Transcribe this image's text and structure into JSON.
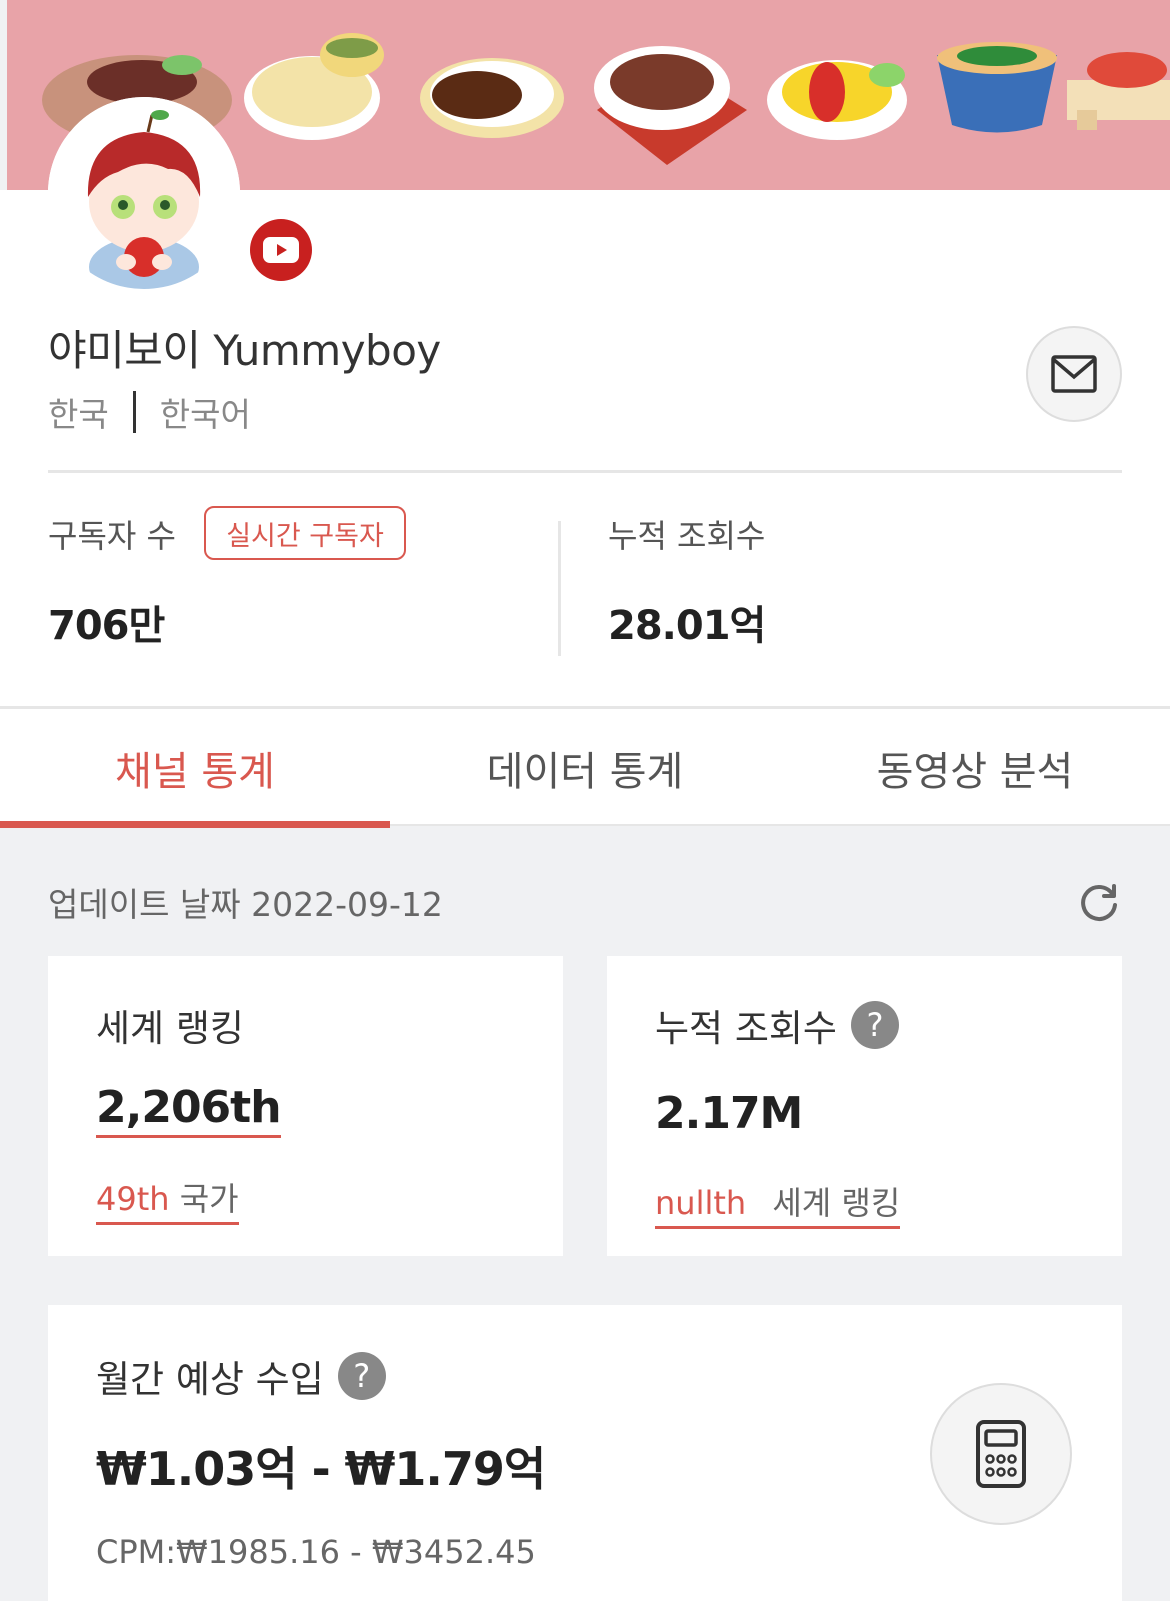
{
  "channel": {
    "name": "야미보이 Yummyboy",
    "country": "한국",
    "language": "한국어",
    "platform_icon": "youtube-icon"
  },
  "stats": {
    "subscribers_label": "구독자 수",
    "realtime_label": "실시간 구독자",
    "subscribers_value": "706만",
    "views_label": "누적 조회수",
    "views_value": "28.01억"
  },
  "tabs": [
    {
      "label": "채널 통계",
      "active": true
    },
    {
      "label": "데이터 통계",
      "active": false
    },
    {
      "label": "동영상 분석",
      "active": false
    }
  ],
  "update": {
    "label": "업데이트 날짜 2022-09-12"
  },
  "cards": {
    "world_rank": {
      "title": "세계 랭킹",
      "value": "2,206th",
      "sub_rank": "49th",
      "sub_label": "국가"
    },
    "views": {
      "title": "누적 조회수",
      "value": "2.17M",
      "sub_rank": "nullth",
      "sub_label": "세계 랭킹"
    },
    "income": {
      "title": "월간 예상 수입",
      "value": "₩1.03억 - ₩1.79억",
      "cpm": "CPM:₩1985.16 - ₩3452.45"
    }
  },
  "colors": {
    "accent": "#d9584f",
    "banner": "#e8a3a8",
    "youtube": "#c8201f"
  }
}
